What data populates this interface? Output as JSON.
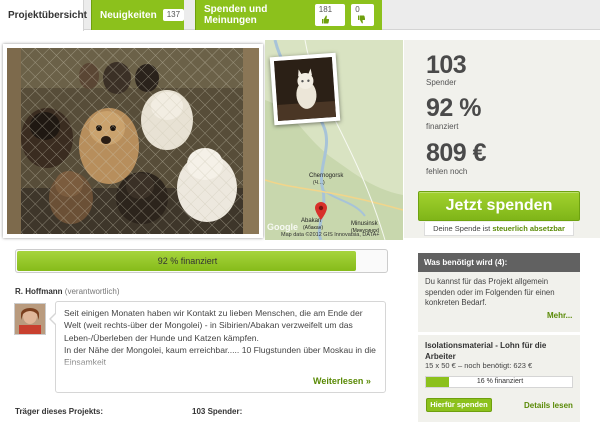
{
  "tabs": {
    "overview": {
      "label": "Projektübersicht"
    },
    "news": {
      "label": "Neuigkeiten",
      "count": "137"
    },
    "donations": {
      "label": "Spenden und Meinungen",
      "likes": "181",
      "dislikes": "0"
    }
  },
  "map": {
    "places": [
      "Chernogorsk",
      "(Ч…)",
      "Abakan",
      "(Абакан)",
      "Minusinsk",
      "(Минусинск)"
    ],
    "google": "Google",
    "copyright": "Map data ©2012 GIS Innovatsia, DATA+"
  },
  "stats": {
    "donors_value": "103",
    "donors_label": "Spender",
    "funded_value": "92 %",
    "funded_label": "finanziert",
    "missing_value": "809 €",
    "missing_label": "fehlen noch"
  },
  "donate": {
    "button": "Jetzt spenden",
    "tax_prefix": "Deine Spende ist ",
    "tax_link": "steuerlich absetzbar"
  },
  "progress": {
    "fraction": 0.92,
    "label": "92 % finanziert"
  },
  "owner": {
    "name": "R. Hoffmann",
    "role": "(verantwortlich)"
  },
  "story": {
    "text": "Seit einigen Monaten haben wir Kontakt zu lieben Menschen, die am Ende der Welt  (weit rechts-über der Mongolei) - in Sibirien/Abakan verzweifelt um das Leben-/Überleben der Hunde und Katzen kämpfen.",
    "text2": "In der Nähe der Mongolei, kaum erreichbar..... 10 Flugstunden über Moskau in die Einsamkeit",
    "more": "Weiterlesen"
  },
  "sections": {
    "owner_title": "Träger dieses Projekts:",
    "donors_title": "103 Spender:"
  },
  "needs": {
    "header": "Was benötigt wird (4):",
    "intro": "Du kannst für das Projekt allgemein spenden oder im Folgenden für einen konkreten Bedarf.",
    "more": "Mehr...",
    "item": {
      "title": "Isolationsmaterial - Lohn für die Arbeiter",
      "meta": "15 x 50 € – noch benötigt: 623 €",
      "fraction": 0.16,
      "progress_label": "16 % finanziert",
      "button": "Hierfür spenden",
      "details": "Details lesen"
    }
  },
  "colors": {
    "accent": "#8cc11c",
    "link": "#5a8a06",
    "header_dark": "#616161",
    "panel": "#f1f1ec"
  }
}
